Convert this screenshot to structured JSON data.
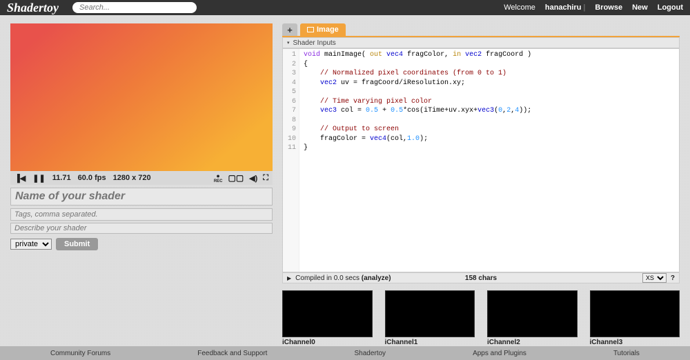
{
  "header": {
    "logo": "Shadertoy",
    "search_placeholder": "Search...",
    "welcome": "Welcome",
    "username": "hanachiru",
    "links": {
      "browse": "Browse",
      "new": "New",
      "logout": "Logout"
    }
  },
  "player": {
    "time": "11.71",
    "fps": "60.0 fps",
    "resolution": "1280 x 720",
    "rec_label": "REC"
  },
  "form": {
    "name_placeholder": "Name of your shader",
    "tags_placeholder": "Tags, comma separated.",
    "desc_placeholder": "Describe your shader",
    "privacy": "private",
    "submit_label": "Submit"
  },
  "tabs": {
    "active_label": "Image"
  },
  "inputs_bar": "Shader Inputs",
  "code": {
    "lines": [
      "1",
      "2",
      "3",
      "4",
      "5",
      "6",
      "7",
      "8",
      "9",
      "10",
      "11"
    ],
    "l1_a": "void",
    "l1_b": " mainImage( ",
    "l1_c": "out ",
    "l1_d": "vec4",
    "l1_e": " fragColor, ",
    "l1_f": "in ",
    "l1_g": "vec2",
    "l1_h": " fragCoord )",
    "l2": "{",
    "l3": "    // Normalized pixel coordinates (from 0 to 1)",
    "l4_a": "    ",
    "l4_b": "vec2",
    "l4_c": " uv = fragCoord/iResolution.xy;",
    "l6": "    // Time varying pixel color",
    "l7_a": "    ",
    "l7_b": "vec3",
    "l7_c": " col = ",
    "l7_d": "0.5",
    "l7_e": " + ",
    "l7_f": "0.5",
    "l7_g": "*cos(iTime+uv.xyx+",
    "l7_h": "vec3",
    "l7_i": "(",
    "l7_j": "0",
    "l7_k": ",",
    "l7_l": "2",
    "l7_m": ",",
    "l7_n": "4",
    "l7_o": "));",
    "l9": "    // Output to screen",
    "l10_a": "    fragColor = ",
    "l10_b": "vec4",
    "l10_c": "(col,",
    "l10_d": "1.0",
    "l10_e": ");",
    "l11": "}"
  },
  "status": {
    "compiled": "Compiled in 0.0 secs ",
    "analyze": "(analyze)",
    "chars": "158 chars",
    "version": "XS"
  },
  "channels": {
    "c0": "iChannel0",
    "c1": "iChannel1",
    "c2": "iChannel2",
    "c3": "iChannel3"
  },
  "footer": {
    "forums": "Community Forums",
    "feedback": "Feedback and Support",
    "brand": "Shadertoy",
    "apps": "Apps and Plugins",
    "tutorials": "Tutorials"
  }
}
